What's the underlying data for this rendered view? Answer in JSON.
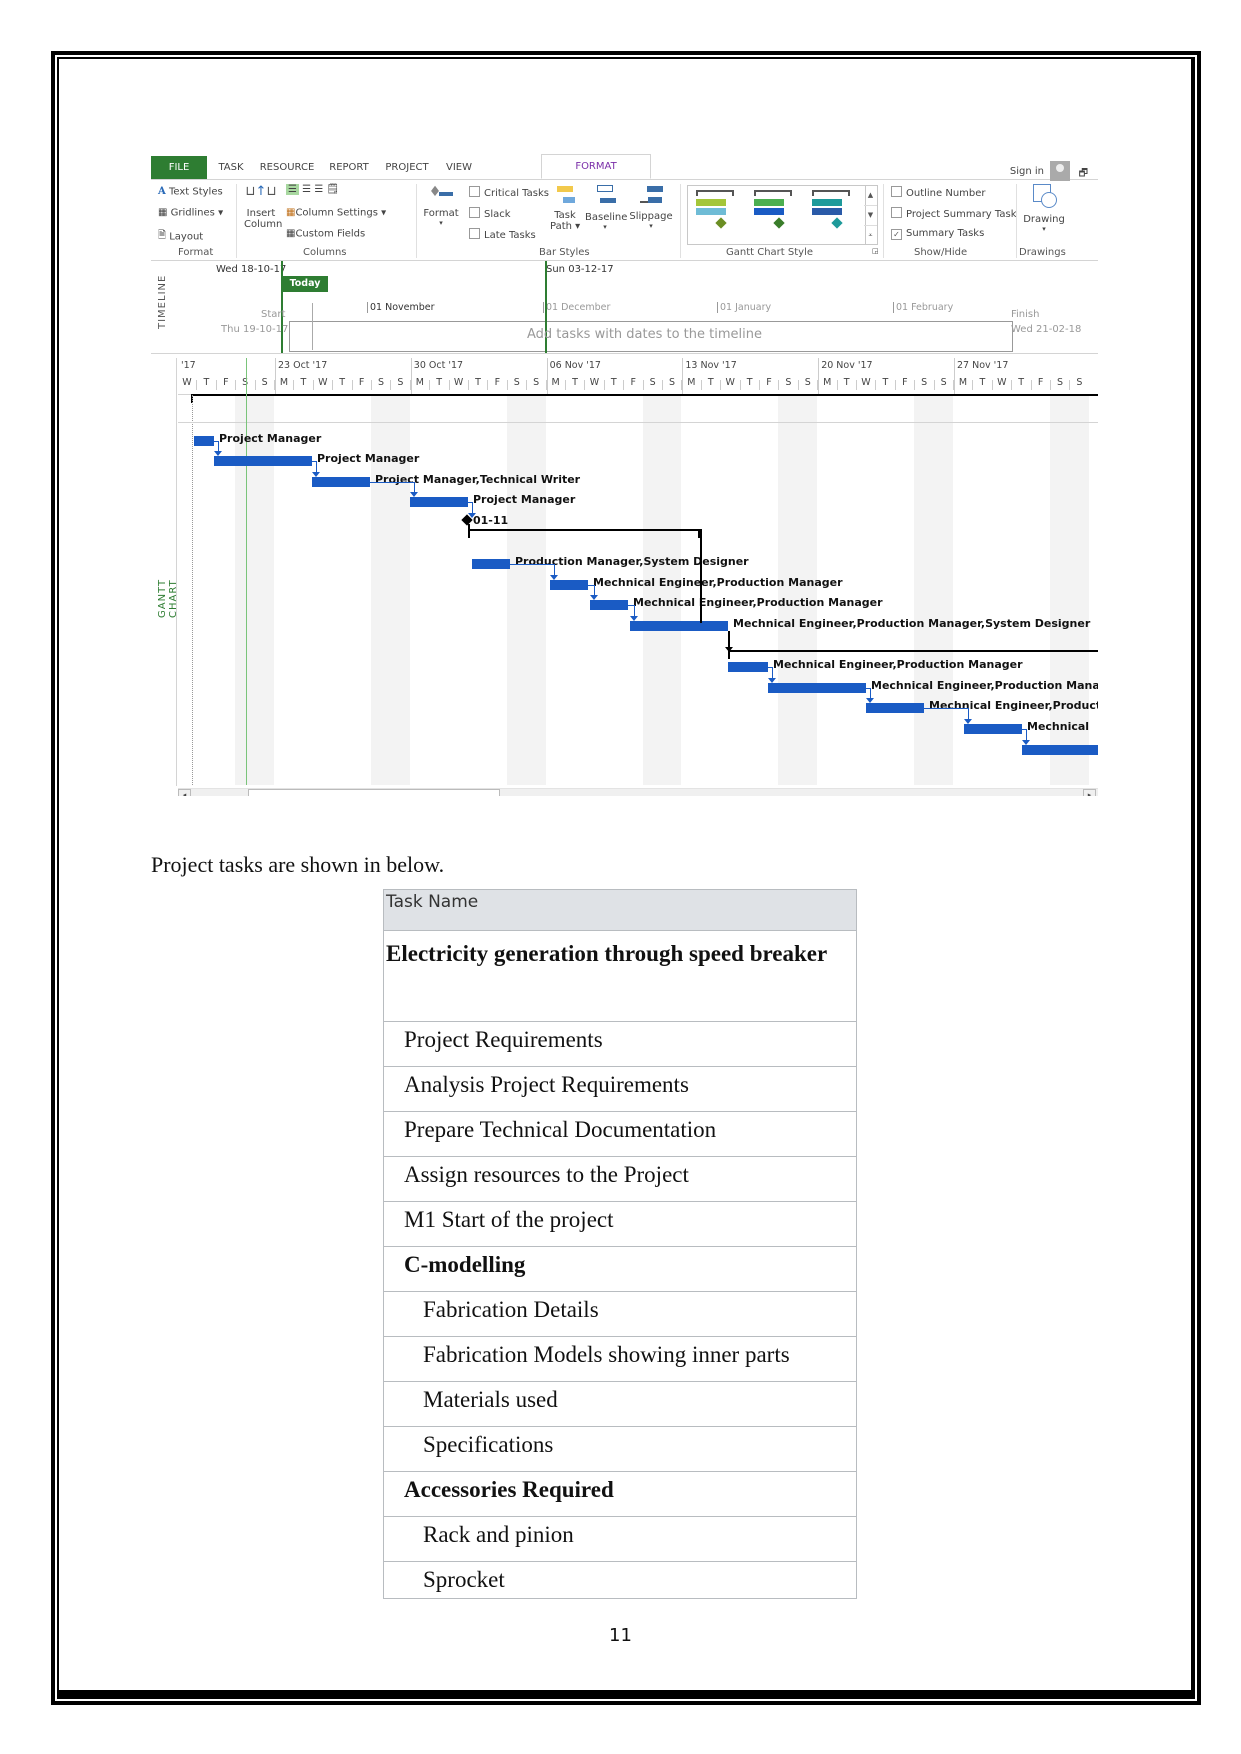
{
  "ribbon": {
    "tabs": [
      "FILE",
      "TASK",
      "RESOURCE",
      "REPORT",
      "PROJECT",
      "VIEW",
      "FORMAT"
    ],
    "active_tab": "FORMAT",
    "sign_in": "Sign in",
    "format_group": {
      "text_styles": "Text Styles",
      "gridlines": "Gridlines",
      "layout": "Layout",
      "label": "Format"
    },
    "columns_group": {
      "insert_column_line1": "Insert",
      "insert_column_line2": "Column",
      "column_settings": "Column Settings",
      "custom_fields": "Custom Fields",
      "label": "Columns"
    },
    "bar_styles_group": {
      "format": "Format",
      "critical_tasks": "Critical Tasks",
      "slack": "Slack",
      "late_tasks": "Late Tasks",
      "task_path_line1": "Task",
      "task_path_line2": "Path",
      "baseline": "Baseline",
      "slippage": "Slippage",
      "label": "Bar Styles"
    },
    "gantt_style_group": {
      "label": "Gantt Chart Style"
    },
    "show_hide_group": {
      "outline_number": "Outline Number",
      "outline_number_checked": false,
      "project_summary_task": "Project Summary Task",
      "project_summary_task_checked": false,
      "summary_tasks": "Summary Tasks",
      "summary_tasks_checked": true,
      "label": "Show/Hide"
    },
    "drawings_group": {
      "drawing": "Drawing",
      "label": "Drawings"
    },
    "colors": {
      "file_tab": "#2e7d32",
      "active_tab_text": "#7a2da8"
    }
  },
  "timeline": {
    "side_label": "TIMELINE",
    "today_date": "Wed 18-10-17",
    "today_flag": "Today",
    "start_label": "Start",
    "start_date": "Thu 19-10-17",
    "mid_date": "Sun 03-12-17",
    "finish_label": "Finish",
    "finish_date": "Wed 21-02-18",
    "placeholder": "Add tasks with dates to the timeline",
    "months": [
      "01 November",
      "01 December",
      "01 January",
      "01 February"
    ]
  },
  "gantt": {
    "side_label": "GANTT CHART",
    "weeks": [
      "'17",
      "23 Oct '17",
      "30 Oct '17",
      "06 Nov '17",
      "13 Nov '17",
      "20 Nov '17",
      "27 Nov '17"
    ],
    "days": [
      "W",
      "T",
      "F",
      "S",
      "S",
      "M",
      "T",
      "W",
      "T",
      "F",
      "S",
      "S",
      "M",
      "T",
      "W",
      "T",
      "F",
      "S",
      "S",
      "M",
      "T",
      "W",
      "T",
      "F",
      "S",
      "S",
      "M",
      "T",
      "W",
      "T",
      "F",
      "S",
      "S",
      "M",
      "T",
      "W",
      "T",
      "F",
      "S",
      "S",
      "M",
      "T",
      "W",
      "T",
      "F",
      "S",
      "S"
    ],
    "bar_color": "#1a5bc4",
    "bars": [
      {
        "resource": "Project Manager"
      },
      {
        "resource": "Project Manager"
      },
      {
        "resource": "Project Manager,Technical Writer"
      },
      {
        "resource": "Project Manager"
      },
      {
        "resource": "01-11",
        "milestone": true
      },
      {
        "resource": "Production Manager,System Designer"
      },
      {
        "resource": "Mechnical Engineer,Production Manager"
      },
      {
        "resource": "Mechnical Engineer,Production Manager"
      },
      {
        "resource": "Mechnical Engineer,Production Manager,System Designer"
      },
      {
        "resource": "Mechnical Engineer,Production Manager"
      },
      {
        "resource": "Mechnical Engineer,Production Manag"
      },
      {
        "resource": "Mechnical Engineer,Product"
      },
      {
        "resource": "Mechnical"
      },
      {
        "resource": ""
      }
    ]
  },
  "document": {
    "intro": "Project tasks are shown in below.",
    "table": {
      "header": "Task Name",
      "rows": [
        {
          "name": "Electricity generation through speed breaker",
          "level": 0,
          "bold": true
        },
        {
          "name": "Project Requirements",
          "level": 1,
          "bold": false
        },
        {
          "name": "Analysis Project Requirements",
          "level": 1,
          "bold": false
        },
        {
          "name": "Prepare Technical Documentation",
          "level": 1,
          "bold": false
        },
        {
          "name": "Assign resources to the Project",
          "level": 1,
          "bold": false
        },
        {
          "name": "M1 Start of the project",
          "level": 1,
          "bold": false
        },
        {
          "name": "C-modelling",
          "level": 1,
          "bold": true
        },
        {
          "name": "Fabrication Details",
          "level": 2,
          "bold": false
        },
        {
          "name": "Fabrication Models showing inner parts",
          "level": 2,
          "bold": false
        },
        {
          "name": "Materials used",
          "level": 2,
          "bold": false
        },
        {
          "name": "Specifications",
          "level": 2,
          "bold": false
        },
        {
          "name": "Accessories Required",
          "level": 1,
          "bold": true
        },
        {
          "name": "Rack and pinion",
          "level": 2,
          "bold": false
        },
        {
          "name": "Sprocket",
          "level": 2,
          "bold": false
        }
      ]
    },
    "page_number": "11"
  }
}
